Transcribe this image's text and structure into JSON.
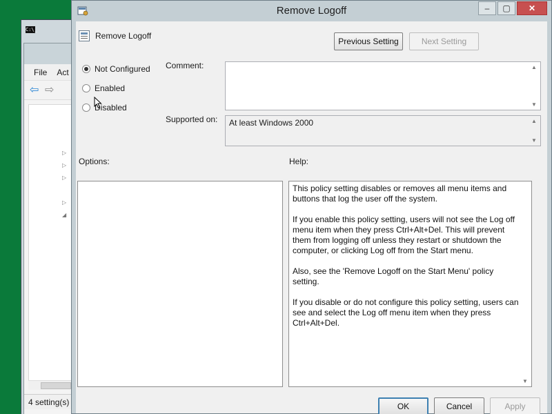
{
  "background": {
    "console_icon": "C:\\_",
    "editor": {
      "menu": [
        "File",
        "Act"
      ],
      "status": "4 setting(s)"
    }
  },
  "dialog": {
    "title": "Remove Logoff",
    "policy_name": "Remove Logoff",
    "window_buttons": {
      "minimize": "–",
      "maximize": "▢",
      "close": "✕"
    },
    "prev_button": "Previous Setting",
    "next_button": "Next Setting",
    "state_options": [
      {
        "label": "Not Configured",
        "checked": true
      },
      {
        "label": "Enabled",
        "checked": false
      },
      {
        "label": "Disabled",
        "checked": false
      }
    ],
    "comment_label": "Comment:",
    "comment_value": "",
    "supported_label": "Supported on:",
    "supported_value": "At least Windows 2000",
    "options_label": "Options:",
    "help_label": "Help:",
    "help_text": "This policy setting disables or removes all menu items and buttons that log the user off the system.\n\nIf you enable this policy setting, users will not see the Log off menu item when they press Ctrl+Alt+Del. This will prevent them from logging off unless they restart or shutdown the computer, or clicking Log off from the Start menu.\n\nAlso, see the 'Remove Logoff on the Start Menu' policy setting.\n\nIf you disable or do not configure this policy setting, users can see and select the Log off menu item when they press Ctrl+Alt+Del.",
    "ok_button": "OK",
    "cancel_button": "Cancel",
    "apply_button": "Apply"
  },
  "colors": {
    "desktop": "#0a7a3a",
    "close_button": "#c75050",
    "default_button_border": "#3c7fb1"
  },
  "icons": [
    "policy-icon",
    "radio-icon",
    "scroll-arrow-icon",
    "back-arrow-icon",
    "forward-arrow-icon",
    "cursor-icon"
  ]
}
